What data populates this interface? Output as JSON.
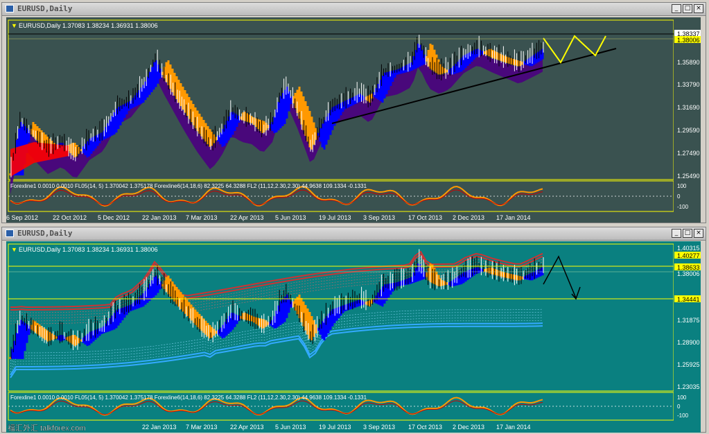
{
  "window1": {
    "title": "EURUSD,Daily",
    "header": "EURUSD,Daily  1.37083 1.38234 1.36931 1.38006",
    "price_labels": [
      "1.38337",
      "1.38006",
      "1.35890",
      "1.33790",
      "1.31690",
      "1.29590",
      "1.27490",
      "1.25490"
    ],
    "indicator_label": "Forexline1 0.0010 0.0010  FL05(14, 5) 1.370042 1.375178  Forexline6(14,18,6) 82.3225 64.3288  FL2 (11,12,2.30,2.30) 44.9638 109.1334 -0.1331",
    "indicator_levels": [
      "100",
      "0",
      "-100"
    ],
    "dates": [
      "6 Sep 2012",
      "22 Oct 2012",
      "5 Dec 2012",
      "22 Jan 2013",
      "7 Mar 2013",
      "22 Apr 2013",
      "5 Jun 2013",
      "19 Jul 2013",
      "3 Sep 2013",
      "17 Oct 2013",
      "2 Dec 2013",
      "17 Jan 2014"
    ]
  },
  "window2": {
    "title": "EURUSD,Daily",
    "header": "EURUSD,Daily  1.37083 1.38234 1.36931 1.38006",
    "price_labels": [
      "1.40315",
      "1.40277",
      "1.38633",
      "1.38006",
      "1.34441",
      "1.31875",
      "1.28900",
      "1.25925",
      "1.23035"
    ],
    "indicator_label": "Forexline1 0.0010 0.0010  FL05(14, 5) 1.370042 1.375178  Forexline6(14,18,6) 82.3225 64.3288  FL2 (11,12,2.30,2.30) 44.9638 109.1334 -0.1331",
    "indicator_levels": [
      "100",
      "0",
      "-100"
    ],
    "dates": [
      "22 Jan 2013",
      "7 Mar 2013",
      "22 Apr 2013",
      "5 Jun 2013",
      "19 Jul 2013",
      "3 Sep 2013",
      "17 Oct 2013",
      "2 Dec 2013",
      "17 Jan 2014"
    ],
    "watermark": "福汇外汇 talkforex.com"
  },
  "buttons": {
    "minimize": "_",
    "maximize": "□",
    "close": "×"
  },
  "colors": {
    "bg1": "#3a5250",
    "bg2": "#0a8080",
    "frame": "#ffff00",
    "bull": "#0000ff",
    "bear": "#ff9900",
    "cloud": "#4b0080",
    "red": "#ff0000",
    "band_red": "#cc3333",
    "band_blue": "#33aaff"
  }
}
